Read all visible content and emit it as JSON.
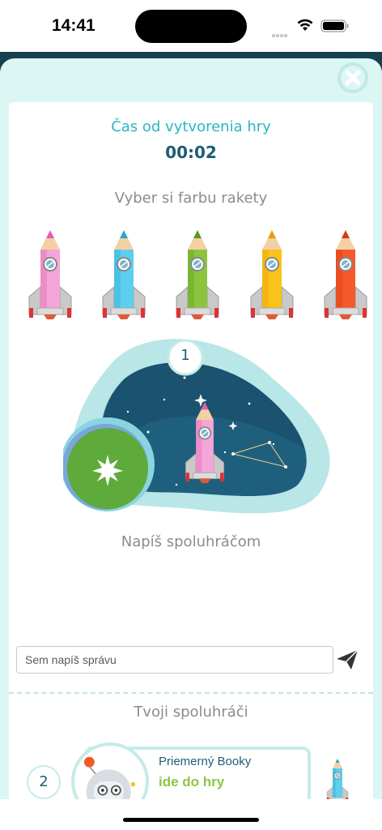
{
  "status_bar": {
    "time": "14:41"
  },
  "game": {
    "timer_label": "Čas od vytvorenia hry",
    "timer_value": "00:02",
    "choose_color_label": "Vyber si farbu rakety",
    "rocket_colors": [
      {
        "name": "pink",
        "body": "#f4a6d8",
        "tip": "#e25db3"
      },
      {
        "name": "blue",
        "body": "#5ccfee",
        "tip": "#2aa6d1"
      },
      {
        "name": "green",
        "body": "#8bc53f",
        "tip": "#5a9a1f"
      },
      {
        "name": "yellow",
        "body": "#f9c31b",
        "tip": "#e9a000"
      },
      {
        "name": "red",
        "body": "#f4592a",
        "tip": "#d63a12"
      }
    ],
    "player_slot_number": "1",
    "write_teammates_label": "Napíš spoluhráčom",
    "message_placeholder": "Sem napíš správu",
    "players_title": "Tvoji spoluhráči",
    "players": [
      {
        "number": "2",
        "name": "Priemerný Booky",
        "status": "ide do hry",
        "rocket_color": "#5ccfee"
      }
    ]
  },
  "colors": {
    "accent_teal": "#2ab7c1",
    "dark_teal": "#1d5d73",
    "sheet_bg": "#dcf6f3",
    "status_green": "#8dc63f"
  }
}
